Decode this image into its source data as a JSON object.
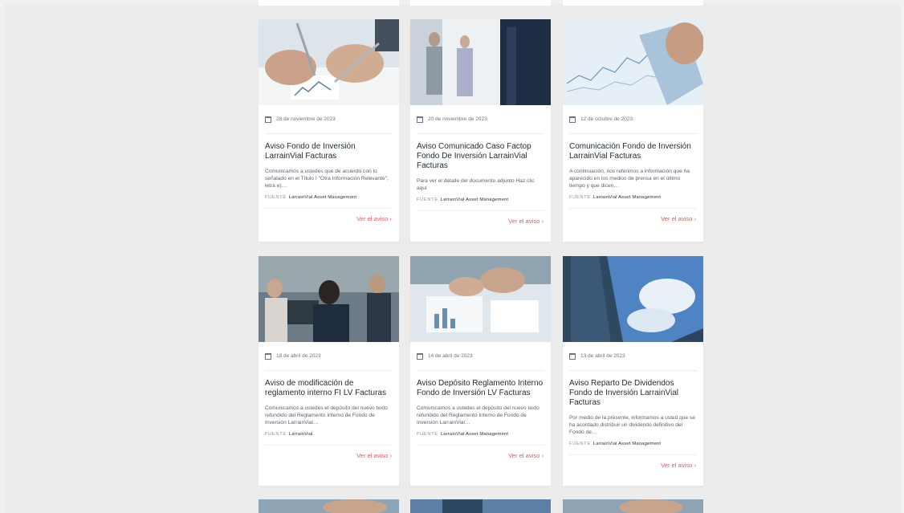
{
  "source_label": "FUENTE",
  "link_chevron": "›",
  "cards": [
    {
      "date": "28 de noviembre de 2023",
      "title": "Aviso Fondo de Inversión LarrainVial Facturas",
      "description": "Comunicamos a ustedes que de acuerdo con lo señalado en el Título I \"Otra Información Relevante\", letra e)…",
      "source": "LarrainVial Asset Management",
      "link": "Ver el aviso"
    },
    {
      "date": "20 de noviembre de 2023",
      "title": "Aviso Comunicado Caso Factop Fondo De Inversión LarrainVial Facturas",
      "description": "Para ver el detalle del documento adjunto Haz clic aquí",
      "source": "LarrainVial Asset Management",
      "link": "Ver el aviso"
    },
    {
      "date": "12 de octubre de 2023",
      "title": "Comunicación Fondo de Inversión LarrainVial Facturas",
      "description": "A continuación, nos referimos a información que ha aparecido en los medios de prensa en el último tiempo y que dicen…",
      "source": "LarrainVial Asset Management",
      "link": "Ver el aviso"
    },
    {
      "date": "18 de abril de 2023",
      "title": "Aviso de modificación de reglamento interno FI LV Facturas",
      "description": "Comunicamos a ustedes el depósito del nuevo texto refundido del Reglamento Interno de Fondo de Inversión LarrainVial…",
      "source": "LarrainVial",
      "link": "Ver el aviso"
    },
    {
      "date": "14 de abril de 2023",
      "title": "Aviso Depósito Reglamento Interno Fondo de Inversión LV Facturas",
      "description": "Comunicamos a ustedes el depósito del nuevo texto refundido del Reglamento Interno de Fondo de Inversión LarrainVial…",
      "source": "LarrainVial Asset Management",
      "link": "Ver el aviso"
    },
    {
      "date": "13 de abril de 2023",
      "title": "Aviso Reparto De Dividendos Fondo de Inversión LarrainVial Facturas",
      "description": "Por medio de la presente, informamos a usted que se ha acordado distribuir un dividendo definitivo del Fondo de…",
      "source": "LarrainVial Asset Management",
      "link": "Ver el aviso"
    }
  ],
  "colors": {
    "accent": "#e0565f",
    "background": "#ececec",
    "card": "#ffffff"
  }
}
